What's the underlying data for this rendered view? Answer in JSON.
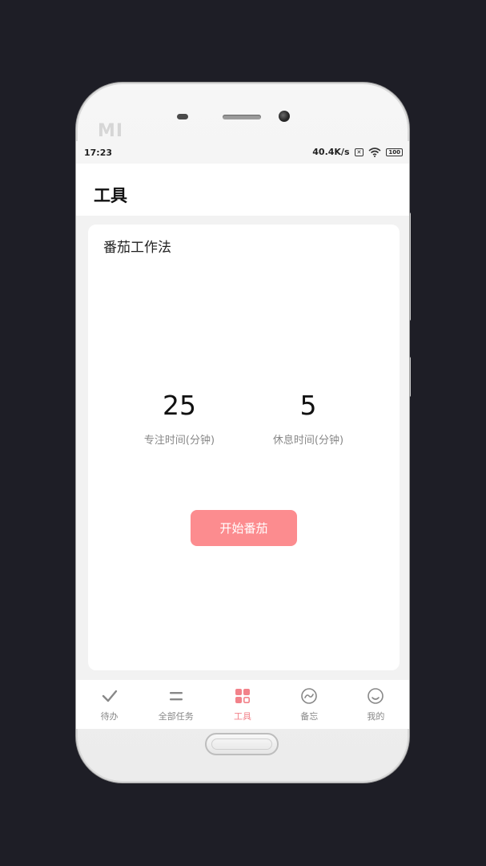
{
  "device": {
    "brand_logo": "MI"
  },
  "status_bar": {
    "time": "17:23",
    "network_speed": "40.4K/s",
    "sim_icon_text": "✕",
    "battery_level": "100"
  },
  "header": {
    "title": "工具"
  },
  "card": {
    "title": "番茄工作法",
    "focus": {
      "value": "25",
      "label": "专注时间(分钟)"
    },
    "rest": {
      "value": "5",
      "label": "休息时间(分钟)"
    },
    "start_button_label": "开始番茄"
  },
  "bottom_nav": {
    "items": [
      {
        "label": "待办",
        "icon": "check-icon",
        "active": false
      },
      {
        "label": "全部任务",
        "icon": "list-icon",
        "active": false
      },
      {
        "label": "工具",
        "icon": "grid-icon",
        "active": true
      },
      {
        "label": "备忘",
        "icon": "memo-icon",
        "active": false
      },
      {
        "label": "我的",
        "icon": "smile-icon",
        "active": false
      }
    ]
  },
  "colors": {
    "accent": "#fc8c8f",
    "nav_active": "#f2828a",
    "nav_inactive": "#888888",
    "background": "#1e1e26"
  }
}
